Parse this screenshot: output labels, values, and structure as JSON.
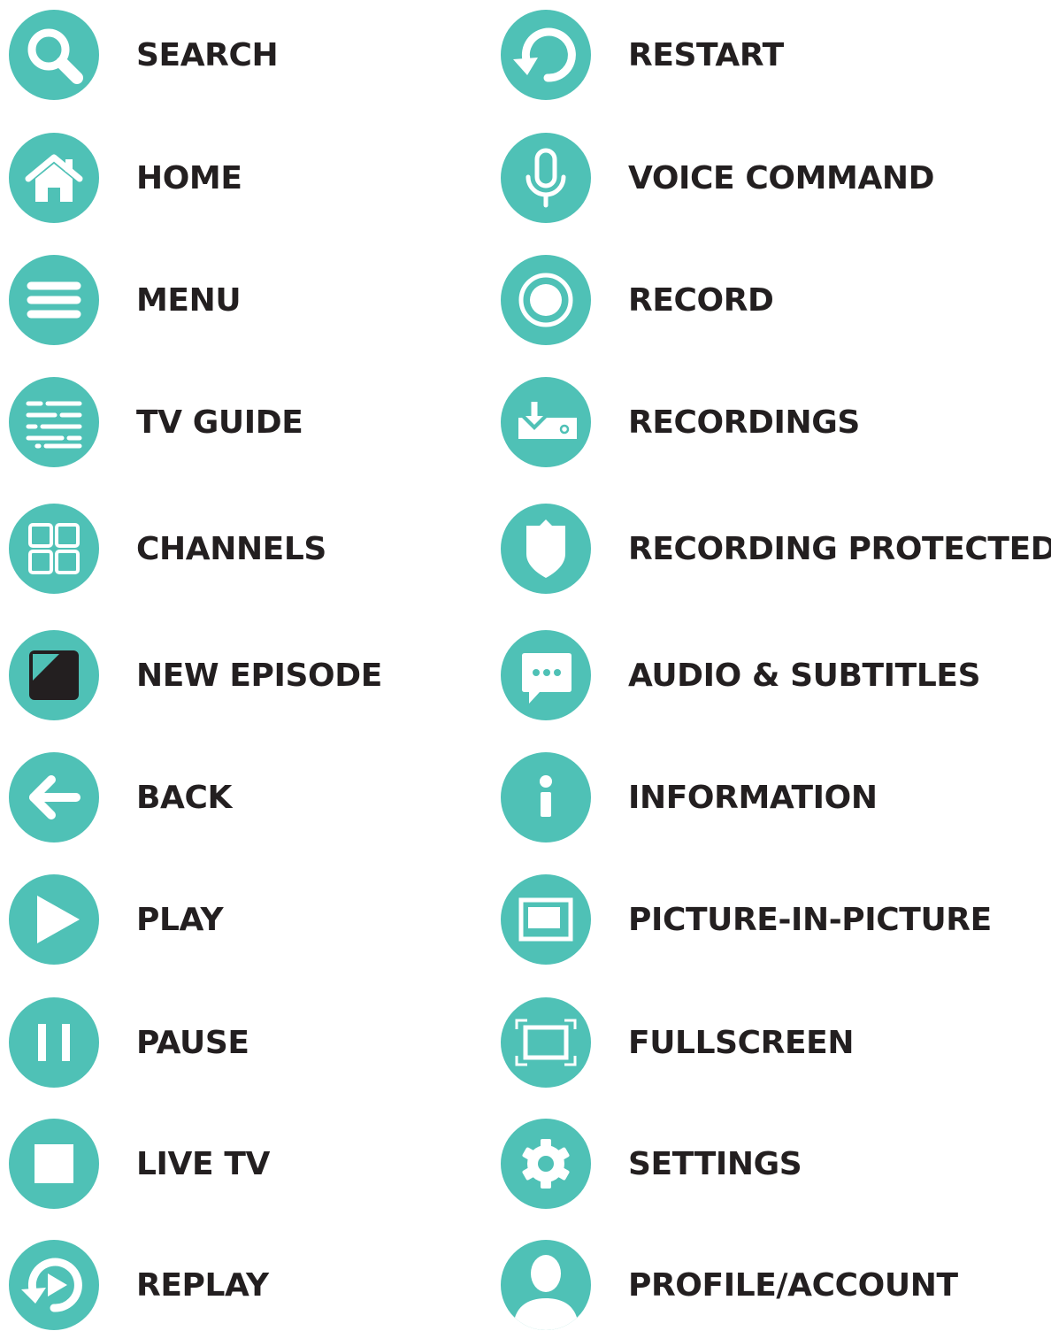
{
  "accent_color": "#4fc1b6",
  "text_color": "#231f20",
  "left_column": [
    {
      "label": "SEARCH",
      "icon": "search-icon"
    },
    {
      "label": "HOME",
      "icon": "home-icon"
    },
    {
      "label": "MENU",
      "icon": "menu-icon"
    },
    {
      "label": "TV GUIDE",
      "icon": "tv-guide-icon"
    },
    {
      "label": "CHANNELS",
      "icon": "channels-icon"
    },
    {
      "label": "NEW EPISODE",
      "icon": "new-episode-icon"
    },
    {
      "label": "BACK",
      "icon": "back-arrow-icon"
    },
    {
      "label": "PLAY",
      "icon": "play-icon"
    },
    {
      "label": "PAUSE",
      "icon": "pause-icon"
    },
    {
      "label": "LIVE TV",
      "icon": "live-tv-icon"
    },
    {
      "label": "REPLAY",
      "icon": "replay-icon"
    }
  ],
  "right_column": [
    {
      "label": "RESTART",
      "icon": "restart-icon"
    },
    {
      "label": "VOICE COMMAND",
      "icon": "microphone-icon"
    },
    {
      "label": "RECORD",
      "icon": "record-icon"
    },
    {
      "label": "RECORDINGS",
      "icon": "recordings-icon"
    },
    {
      "label": "RECORDING PROTECTED",
      "icon": "shield-icon"
    },
    {
      "label": "AUDIO & SUBTITLES",
      "icon": "speech-bubble-icon"
    },
    {
      "label": "INFORMATION",
      "icon": "info-icon"
    },
    {
      "label": "PICTURE-IN-PICTURE",
      "icon": "picture-in-picture-icon"
    },
    {
      "label": "FULLSCREEN",
      "icon": "fullscreen-icon"
    },
    {
      "label": "SETTINGS",
      "icon": "gear-icon"
    },
    {
      "label": "PROFILE/ACCOUNT",
      "icon": "profile-icon"
    }
  ]
}
